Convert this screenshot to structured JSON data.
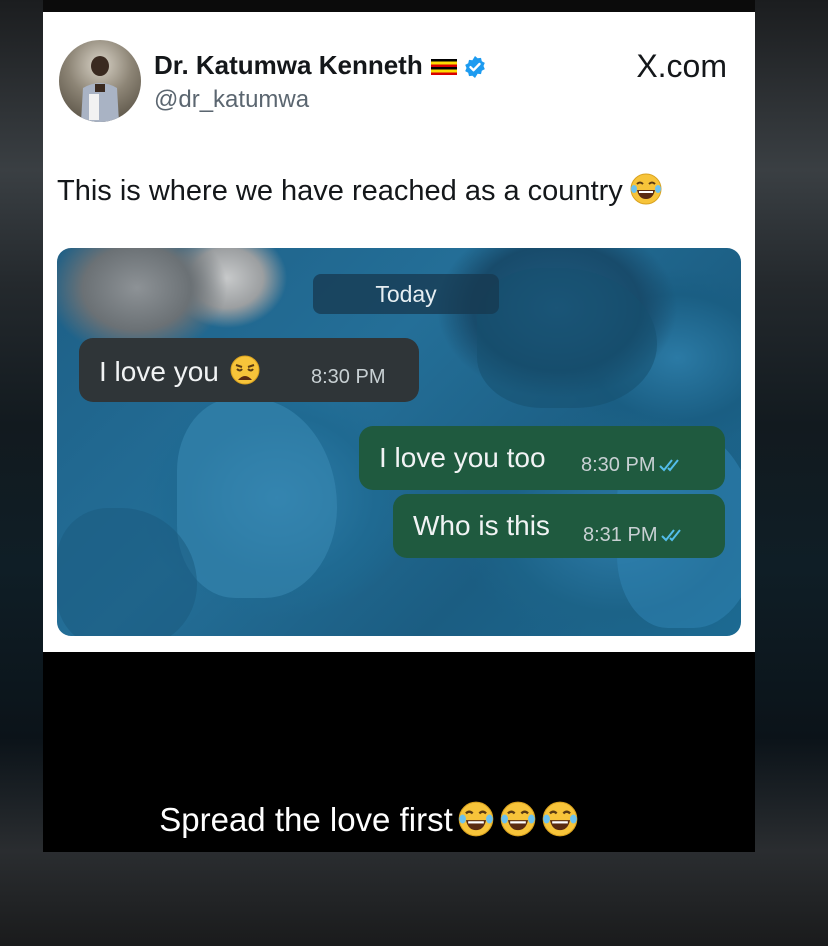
{
  "post": {
    "author_name": "Dr. Katumwa Kenneth",
    "handle": "@dr_katumwa",
    "site": "X.com",
    "text": "This is where we have reached as a country",
    "icons": {
      "flag": "uganda-flag-icon",
      "verified": "verified-badge-icon",
      "text_emoji": "laughing-tears-emoji-icon"
    }
  },
  "chat": {
    "date_label": "Today",
    "messages": [
      {
        "direction": "incoming",
        "text": "I love you",
        "time": "8:30 PM",
        "emoji": "weary-face-emoji-icon"
      },
      {
        "direction": "outgoing",
        "text": "I love you too",
        "time": "8:30 PM",
        "status": "double-check-icon"
      },
      {
        "direction": "outgoing",
        "text": "Who is this",
        "time": "8:31 PM",
        "status": "double-check-icon"
      }
    ],
    "colors": {
      "incoming_bubble": "#2f3538",
      "outgoing_bubble": "#1f5a3f",
      "ticks": "#53bdeb"
    }
  },
  "caption": {
    "text": "Spread the love first",
    "emoji": "laughing-tears-emoji-icon",
    "emoji_count": 3
  }
}
